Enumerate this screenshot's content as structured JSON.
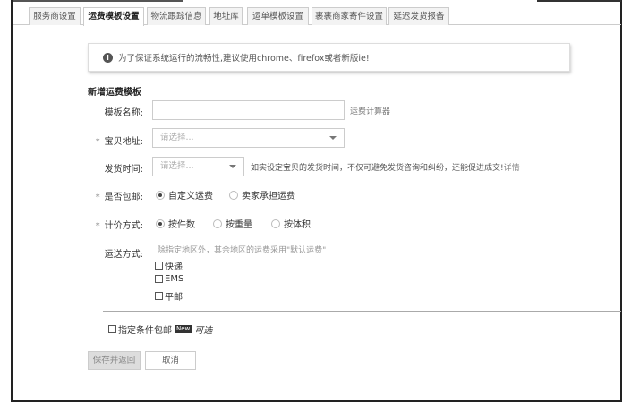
{
  "tabs": [
    "服务商设置",
    "运费模板设置",
    "物流跟踪信息",
    "地址库",
    "运单模板设置",
    "裹裹商家寄件设置",
    "延迟发货报备"
  ],
  "active_tab": 1,
  "notice": "为了保证系统运行的流畅性,建议使用chrome、firefox或者新版ie!",
  "heading": "新增运费模板",
  "form": {
    "name_label": "模板名称:",
    "calc_link": "运费计算器",
    "addr_label": "宝贝地址:",
    "addr_placeholder": "请选择...",
    "time_label": "发货时间:",
    "time_placeholder": "请选择...",
    "time_hint": "如实设定宝贝的发货时间，不仅可避免发货咨询和纠纷，还能促进成交!",
    "detail_link": "详情",
    "free_label": "是否包邮:",
    "free_opts": [
      "自定义运费",
      "卖家承担运费"
    ],
    "price_label": "计价方式:",
    "price_opts": [
      "按件数",
      "按重量",
      "按体积"
    ],
    "ship_label": "运送方式:",
    "ship_hint": "除指定地区外，其余地区的运费采用\"默认运费\"",
    "ship_opts": [
      "快递",
      "EMS",
      "平邮"
    ],
    "cond_label": "指定条件包邮",
    "new_badge": "New",
    "cond_suffix": "可选"
  },
  "buttons": {
    "save": "保存并返回",
    "cancel": "取消"
  },
  "required_mark": "*"
}
